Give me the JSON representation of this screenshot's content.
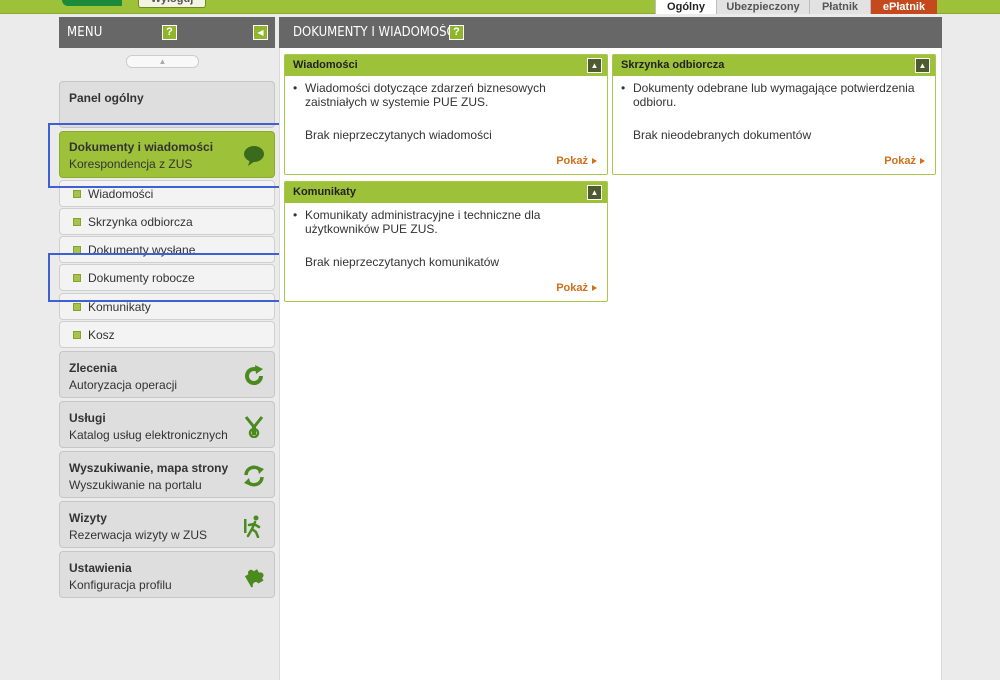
{
  "topbar": {
    "logout_label": "Wyloguj",
    "tabs": [
      {
        "label": "Ogólny",
        "active": true
      },
      {
        "label": "Ubezpieczony",
        "active": false
      },
      {
        "label": "Płatnik",
        "active": false
      },
      {
        "label": "ePłatnik",
        "active": false
      }
    ]
  },
  "menu": {
    "title": "MENU",
    "help": "?",
    "collapse": "◀",
    "scroll_up": "▲",
    "panel_general": "Panel ogólny",
    "documents": {
      "title": "Dokumenty i wiadomości",
      "subtitle": "Korespondencja z ZUS",
      "icon": "speech-bubble-icon"
    },
    "submenu": [
      "Wiadomości",
      "Skrzynka odbiorcza",
      "Dokumenty wysłane",
      "Dokumenty robocze",
      "Komunikaty",
      "Kosz"
    ],
    "sections": [
      {
        "title": "Zlecenia",
        "subtitle": "Autoryzacja operacji",
        "icon": "refresh-arrow-icon"
      },
      {
        "title": "Usługi",
        "subtitle": "Katalog usług elektronicznych",
        "icon": "tools-icon"
      },
      {
        "title": "Wyszukiwanie, mapa strony",
        "subtitle": "Wyszukiwanie na portalu",
        "icon": "sync-icon"
      },
      {
        "title": "Wizyty",
        "subtitle": "Rezerwacja wizyty w ZUS",
        "icon": "walking-person-icon"
      },
      {
        "title": "Ustawienia",
        "subtitle": "Konfiguracja profilu",
        "icon": "puzzle-icon"
      }
    ]
  },
  "main": {
    "title": "DOKUMENTY I WIADOMOŚCI",
    "help": "?",
    "panels": {
      "messages": {
        "title": "Wiadomości",
        "toggle": "▲",
        "bullet": "•",
        "description": "Wiadomości dotyczące zdarzeń biznesowych zaistniałych w systemie PUE ZUS.",
        "empty": "Brak nieprzeczytanych wiadomości",
        "more": "Pokaż"
      },
      "inbox": {
        "title": "Skrzynka odbiorcza",
        "toggle": "▲",
        "bullet": "•",
        "description": "Dokumenty odebrane lub wymagające potwierdzenia odbioru.",
        "empty": "Brak nieodebranych dokumentów",
        "more": "Pokaż"
      },
      "announcements": {
        "title": "Komunikaty",
        "toggle": "▲",
        "bullet": "•",
        "description": "Komunikaty administracyjne i techniczne dla użytkowników PUE ZUS.",
        "empty": "Brak nieprzeczytanych komunikatów",
        "more": "Pokaż"
      }
    }
  },
  "colors": {
    "accent_green": "#9ec13a",
    "header_gray": "#676767",
    "link_orange": "#d0701c",
    "eplatnik_red": "#c4491c",
    "highlight_blue": "#3f5fd4"
  }
}
